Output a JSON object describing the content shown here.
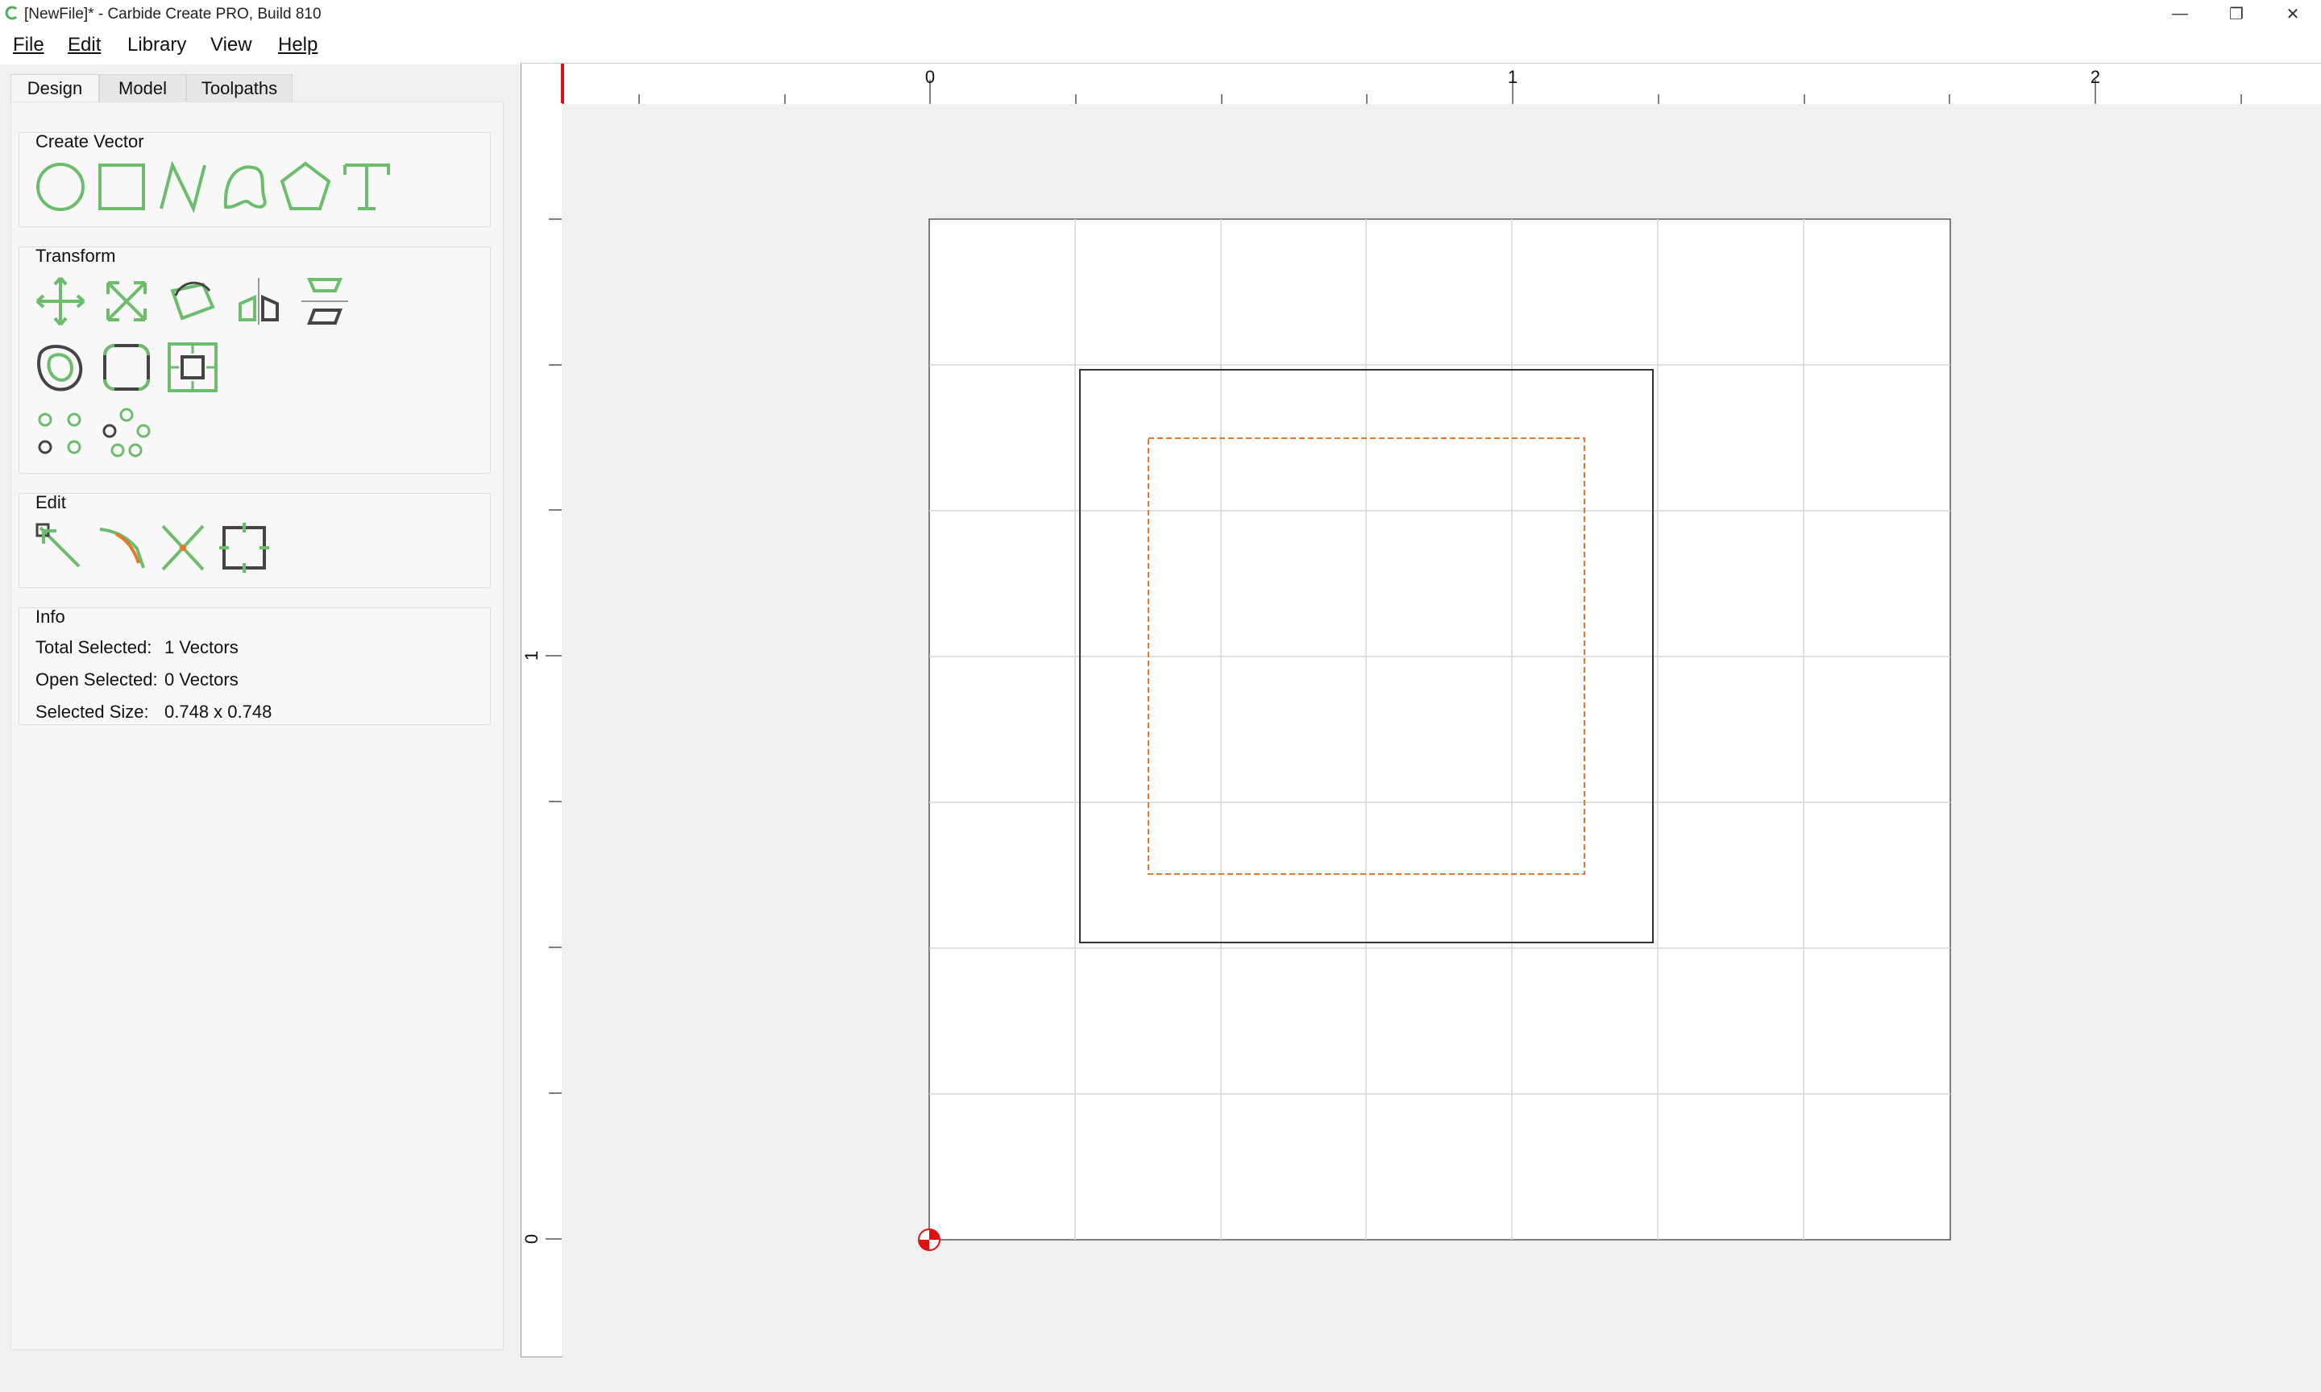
{
  "window": {
    "title": "[NewFile]* - Carbide Create PRO, Build 810",
    "minimize": "—",
    "restore": "❐",
    "close": "✕"
  },
  "menu": [
    "File",
    "Edit",
    "Library",
    "View",
    "Help"
  ],
  "tabs": [
    "Design",
    "Model",
    "Toolpaths"
  ],
  "active_tab": "Design",
  "groups": {
    "create_vector": {
      "title": "Create Vector",
      "tools": [
        "circle-icon",
        "rectangle-icon",
        "polyline-icon",
        "curve-icon",
        "polygon-icon",
        "text-icon"
      ]
    },
    "transform": {
      "title": "Transform",
      "tools": [
        "move-icon",
        "scale-icon",
        "rotate-icon",
        "mirror-icon",
        "align-icon",
        "offset-icon",
        "fillet-icon",
        "center-icon",
        "circular-array-icon",
        "array-icon"
      ]
    },
    "edit": {
      "title": "Edit",
      "tools": [
        "node-edit-icon",
        "join-icon",
        "trim-icon",
        "boolean-icon"
      ]
    },
    "info": {
      "title": "Info",
      "rows": [
        {
          "label": "Total Selected:",
          "value": "1 Vectors"
        },
        {
          "label": "Open Selected:",
          "value": "0 Vectors"
        },
        {
          "label": "Selected Size:",
          "value": "0.748 x 0.748"
        }
      ]
    }
  },
  "rulers": {
    "horizontal_labels": [
      "0",
      "1",
      "2"
    ],
    "vertical_labels": [
      "1",
      "0"
    ]
  },
  "colors": {
    "icon_green": "#6bbd6b",
    "icon_dark": "#444444",
    "toolpath_orange": "#e8772c",
    "origin_red": "#e01010"
  }
}
